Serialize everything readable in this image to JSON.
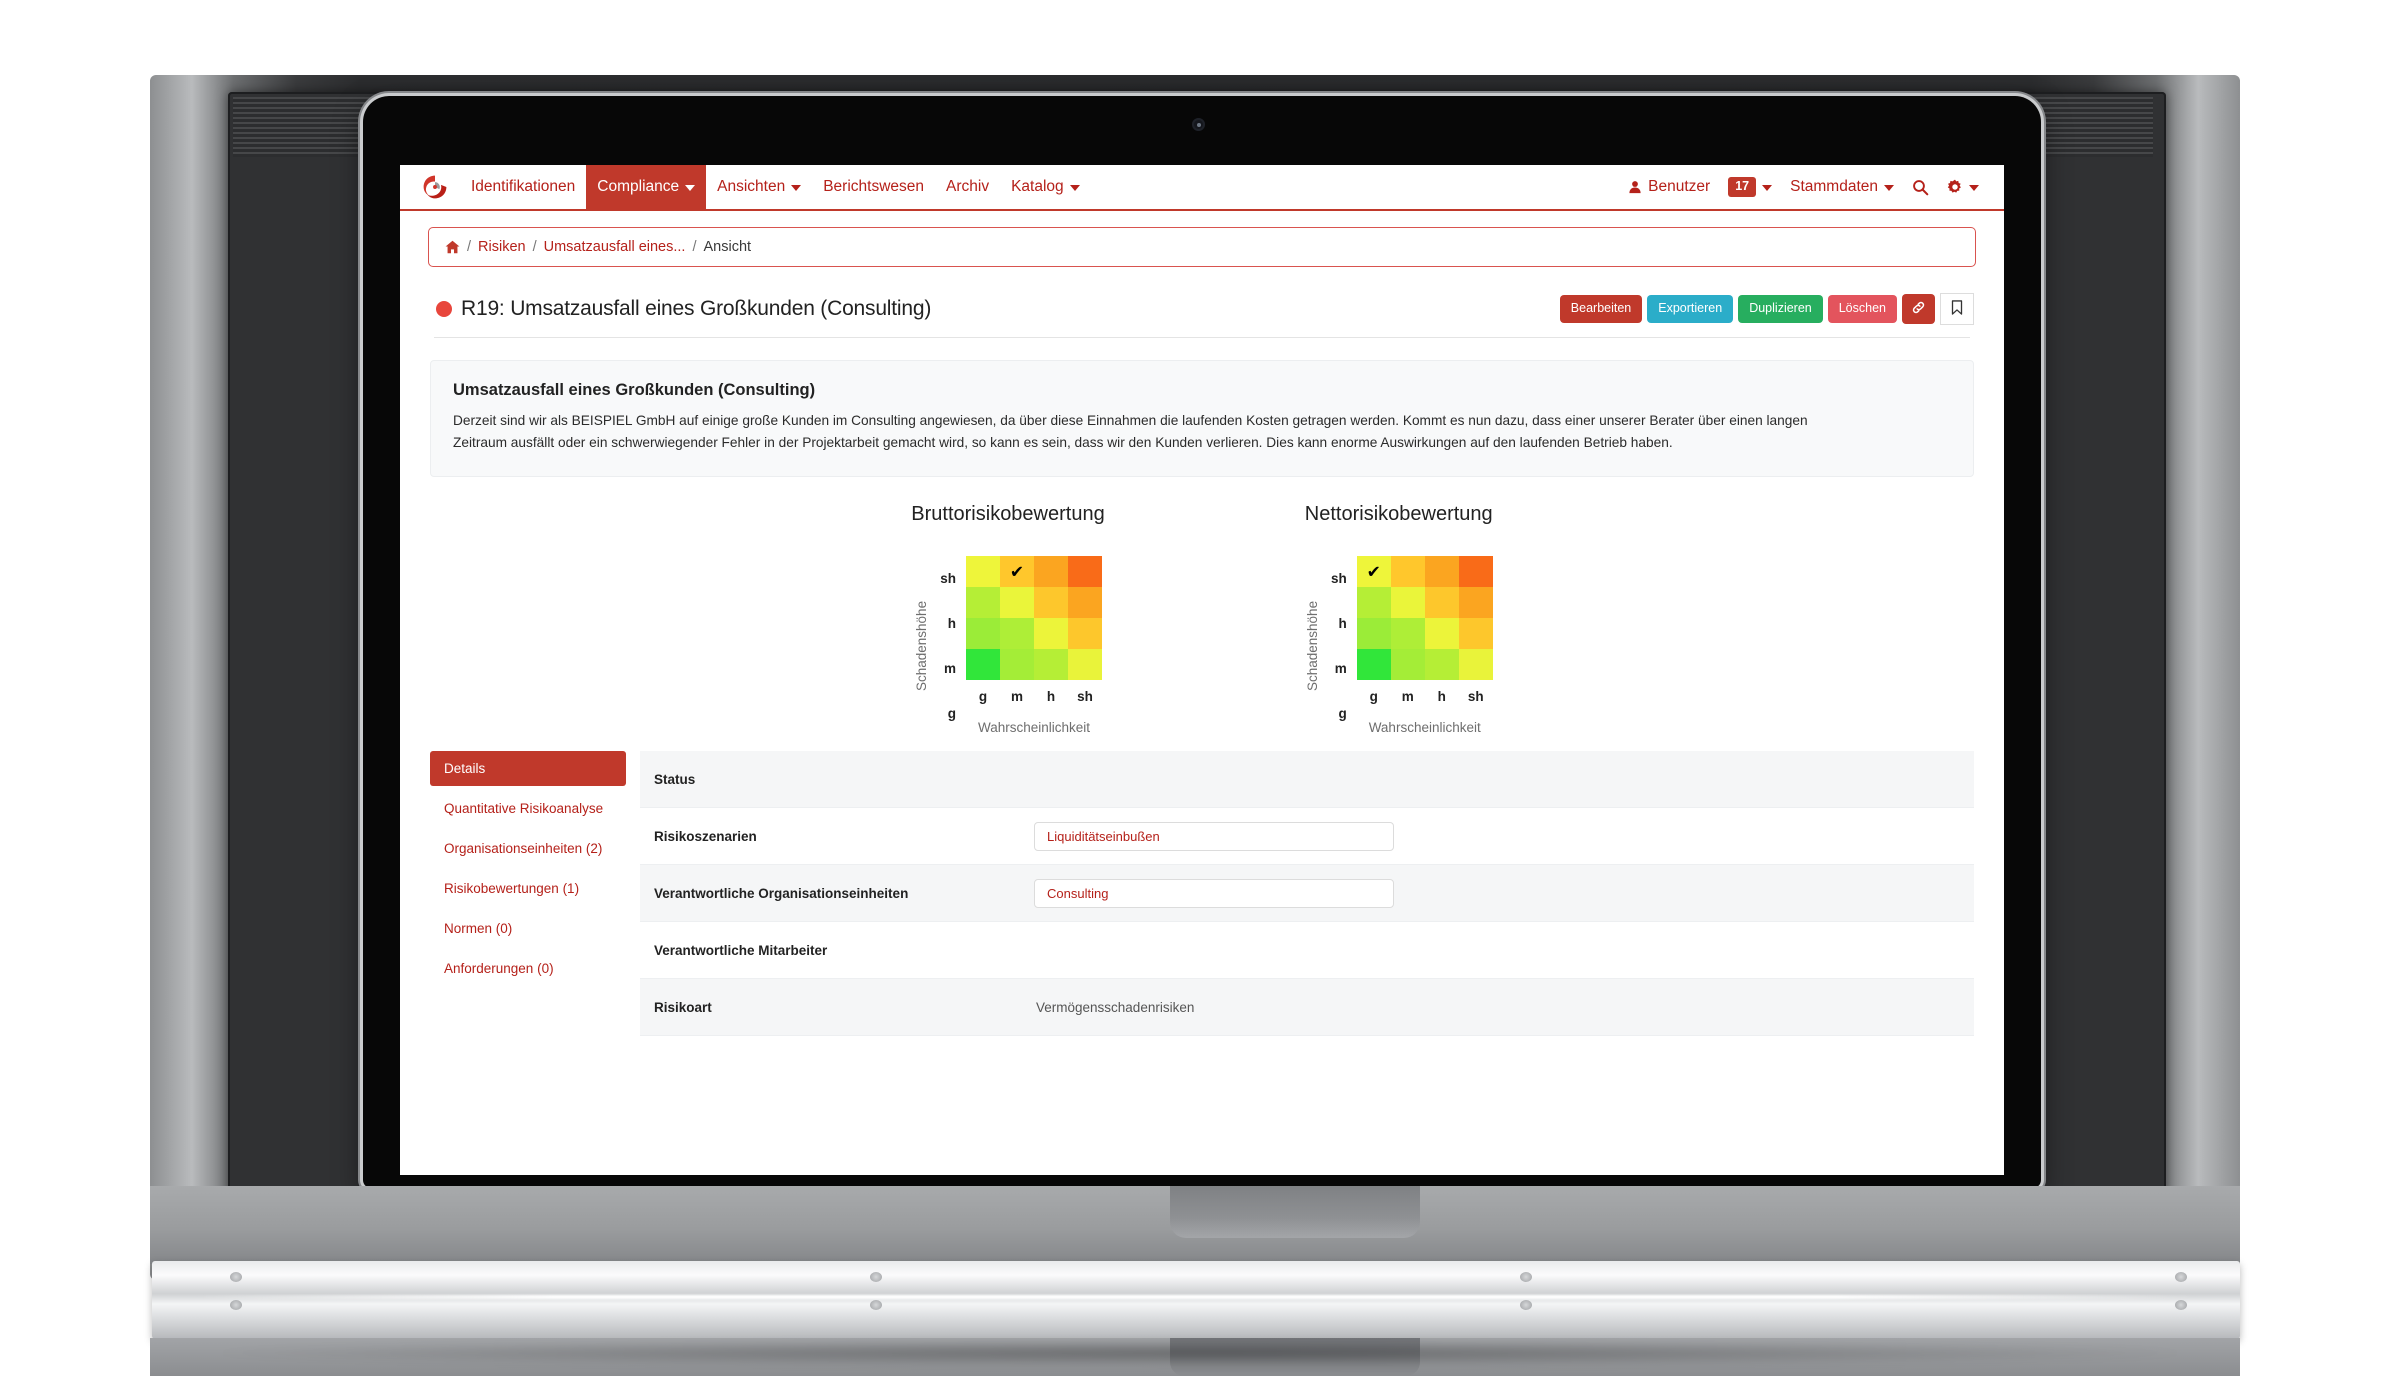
{
  "navbar": {
    "logo_icon": "comma-spiral-logo",
    "left_items": [
      {
        "label": "Identifikationen",
        "has_caret": false,
        "active": false
      },
      {
        "label": "Compliance",
        "has_caret": true,
        "active": true
      },
      {
        "label": "Ansichten",
        "has_caret": true,
        "active": false
      },
      {
        "label": "Berichtswesen",
        "has_caret": false,
        "active": false
      },
      {
        "label": "Archiv",
        "has_caret": false,
        "active": false
      },
      {
        "label": "Katalog",
        "has_caret": true,
        "active": false
      }
    ],
    "user_label": "Benutzer",
    "user_icon": "user-icon",
    "notification_count": "17",
    "masterdata_label": "Stammdaten",
    "search_icon": "search-icon",
    "settings_icon": "gear-icon"
  },
  "breadcrumb": {
    "home_icon": "home-icon",
    "sep": "/",
    "items": [
      "Risiken",
      "Umsatzausfall eines...",
      "Ansicht"
    ]
  },
  "header": {
    "status_dot_color": "#e8463c",
    "title": "R19: Umsatzausfall eines Großkunden (Consulting)",
    "buttons": [
      {
        "label": "Bearbeiten",
        "style": "edit"
      },
      {
        "label": "Exportieren",
        "style": "export"
      },
      {
        "label": "Duplizieren",
        "style": "dup"
      },
      {
        "label": "Löschen",
        "style": "del"
      }
    ],
    "link_icon": "link-icon",
    "bookmark_icon": "bookmark-icon"
  },
  "description": {
    "title": "Umsatzausfall eines Großkunden (Consulting)",
    "body": "Derzeit sind wir als BEISPIEL GmbH auf einige große Kunden im Consulting angewiesen, da über diese Einnahmen die laufenden Kosten getragen werden. Kommt es nun dazu, dass einer unserer Berater über einen langen Zeitraum ausfällt oder ein schwerwiegender Fehler in der Projektarbeit gemacht wird, so kann es sein, dass wir den Kunden verlieren. Dies kann enorme Auswirkungen auf den laufenden Betrieb haben."
  },
  "chart_data": [
    {
      "type": "heatmap",
      "title": "Bruttorisikobewertung",
      "xlabel": "Wahrscheinlichkeit",
      "ylabel": "Schadenshöhe",
      "x_ticks": [
        "g",
        "m",
        "h",
        "sh"
      ],
      "y_ticks": [
        "sh",
        "h",
        "m",
        "g"
      ],
      "marker": "✔",
      "marked_cell": {
        "row": "sh",
        "col": "m",
        "row_index": 0,
        "col_index": 1
      },
      "colors": [
        [
          "#eef53a",
          "#ffc72c",
          "#fba520",
          "#f96b18"
        ],
        [
          "#b5ee36",
          "#eaf53a",
          "#fdc72c",
          "#fba520"
        ],
        [
          "#9bec38",
          "#aeee37",
          "#ecf43a",
          "#fdc72c"
        ],
        [
          "#31e63a",
          "#a4ed37",
          "#b5ee36",
          "#e9f33a"
        ]
      ],
      "values": [
        [
          8,
          12,
          14,
          16
        ],
        [
          5,
          8,
          11,
          13
        ],
        [
          3,
          5,
          8,
          10
        ],
        [
          1,
          3,
          4,
          6
        ]
      ]
    },
    {
      "type": "heatmap",
      "title": "Nettorisikobewertung",
      "xlabel": "Wahrscheinlichkeit",
      "ylabel": "Schadenshöhe",
      "x_ticks": [
        "g",
        "m",
        "h",
        "sh"
      ],
      "y_ticks": [
        "sh",
        "h",
        "m",
        "g"
      ],
      "marker": "✔",
      "marked_cell": {
        "row": "sh",
        "col": "g",
        "row_index": 0,
        "col_index": 0
      },
      "colors": [
        [
          "#eef53a",
          "#ffc72c",
          "#fba520",
          "#f96b18"
        ],
        [
          "#b5ee36",
          "#eaf53a",
          "#fdc72c",
          "#fba520"
        ],
        [
          "#9bec38",
          "#aeee37",
          "#ecf43a",
          "#fdc72c"
        ],
        [
          "#31e63a",
          "#a4ed37",
          "#b5ee36",
          "#e9f33a"
        ]
      ],
      "values": [
        [
          8,
          12,
          14,
          16
        ],
        [
          5,
          8,
          11,
          13
        ],
        [
          3,
          5,
          8,
          10
        ],
        [
          1,
          3,
          4,
          6
        ]
      ]
    }
  ],
  "tabs": [
    {
      "label": "Details",
      "active": true
    },
    {
      "label": "Quantitative Risikoanalyse",
      "active": false
    },
    {
      "label": "Organisationseinheiten (2)",
      "active": false
    },
    {
      "label": "Risikobewertungen (1)",
      "active": false
    },
    {
      "label": "Normen (0)",
      "active": false
    },
    {
      "label": "Anforderungen (0)",
      "active": false
    }
  ],
  "fields": [
    {
      "label": "Status",
      "value": "",
      "kind": "empty",
      "striped": true
    },
    {
      "label": "Risikoszenarien",
      "value": "Liquiditätseinbußen",
      "kind": "pill",
      "striped": false
    },
    {
      "label": "Verantwortliche Organisationseinheiten",
      "value": "Consulting",
      "kind": "pill",
      "striped": true
    },
    {
      "label": "Verantwortliche Mitarbeiter",
      "value": "",
      "kind": "empty",
      "striped": false
    },
    {
      "label": "Risikoart",
      "value": "Vermögensschadenrisiken",
      "kind": "plain",
      "striped": true
    }
  ],
  "theme": {
    "brand_red": "#c0392b",
    "link_red": "#b5211a",
    "export_cyan": "#2badc9",
    "dup_green": "#27ae5f",
    "del_red": "#e3545d"
  }
}
